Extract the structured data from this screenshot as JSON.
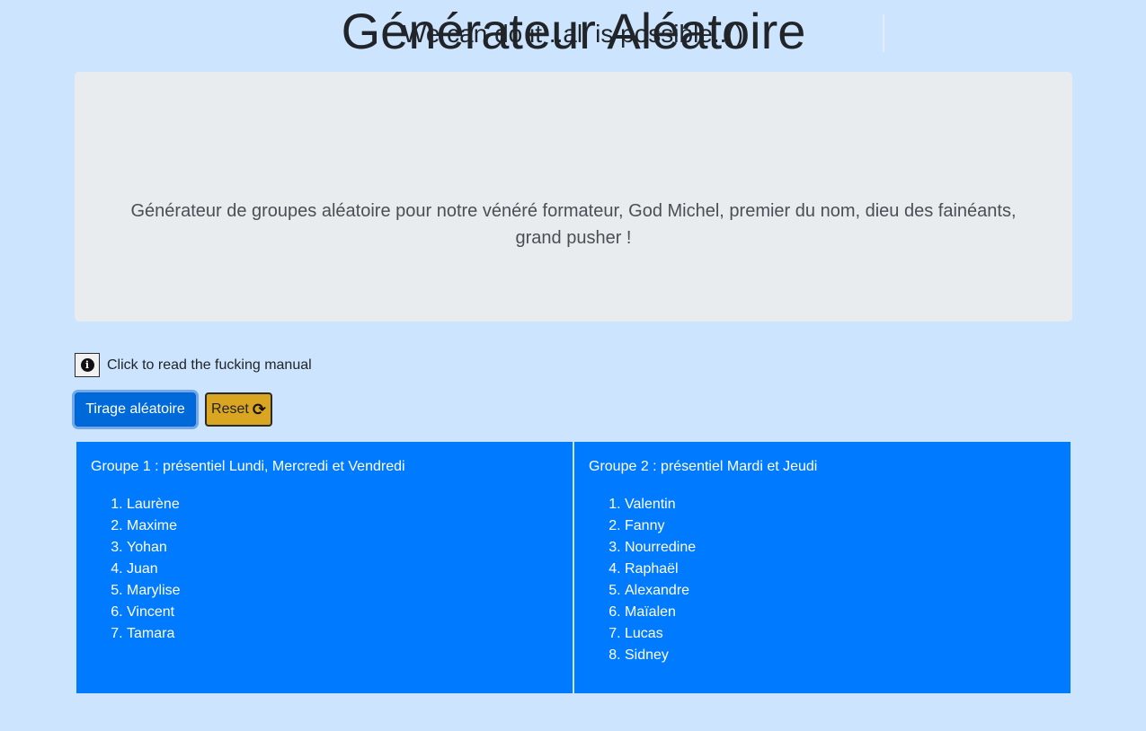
{
  "header": {
    "tagline": "We can do it ..all is possible..()"
  },
  "jumbotron": {
    "title": "Générateur Aléatoire",
    "lead": "Générateur de groupes aléatoire pour notre vénéré formateur, God Michel, premier du nom, dieu des fainéants, grand pusher !"
  },
  "manual": {
    "icon": "info-circle-icon",
    "text": "Click to read the fucking manual"
  },
  "buttons": {
    "draw_label": "Tirage aléatoire",
    "reset_label": "Reset",
    "reset_icon": "refresh-icon"
  },
  "groups": [
    {
      "title": "Groupe 1 : présentiel Lundi, Mercredi et Vendredi",
      "members": [
        "Laurène",
        "Maxime",
        "Yohan",
        "Juan",
        "Marylise",
        "Vincent",
        "Tamara"
      ]
    },
    {
      "title": "Groupe 2 : présentiel Mardi et Jeudi",
      "members": [
        "Valentin",
        "Fanny",
        "Nourredine",
        "Raphaël",
        "Alexandre",
        "Maïalen",
        "Lucas",
        "Sidney"
      ]
    }
  ],
  "colors": {
    "page_background": "#cce4fd",
    "jumbotron_background": "#e9ecef",
    "primary": "#007bff",
    "primary_active": "#0069d9",
    "reset": "#daa520"
  }
}
